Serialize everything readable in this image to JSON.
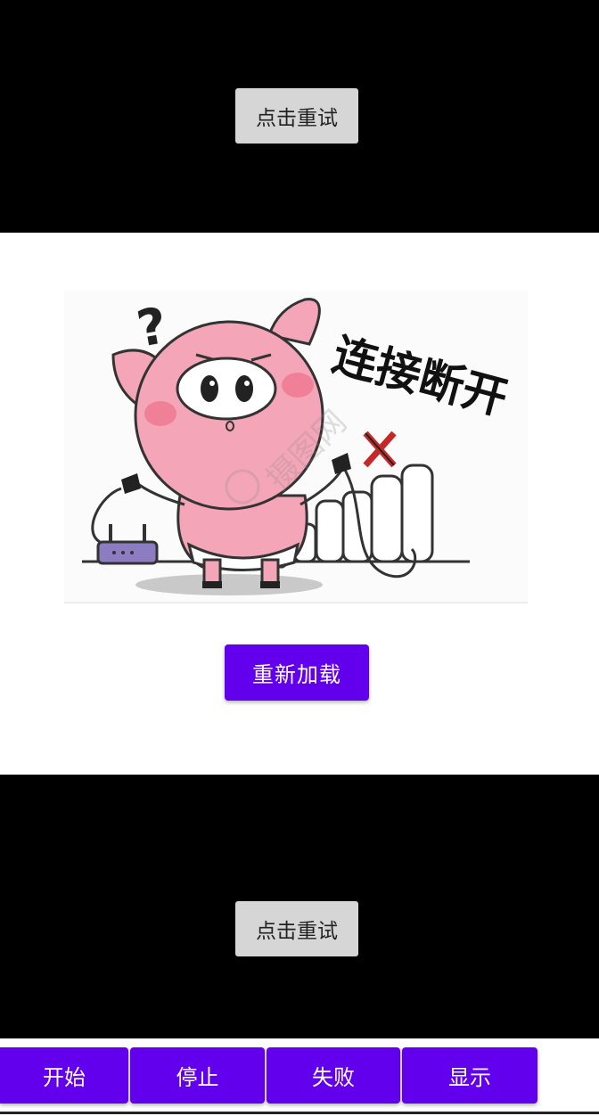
{
  "top_panel": {
    "retry_label": "点击重试"
  },
  "main": {
    "illustration": {
      "caption": "连接断开",
      "watermark": "摄图网"
    },
    "reload_label": "重新加载"
  },
  "bottom_panel": {
    "retry_label": "点击重试"
  },
  "bottom_bar": {
    "start_label": "开始",
    "stop_label": "停止",
    "fail_label": "失败",
    "show_label": "显示"
  },
  "colors": {
    "accent": "#6200ee",
    "panel_bg": "#000000",
    "retry_bg": "#d6d6d6"
  }
}
